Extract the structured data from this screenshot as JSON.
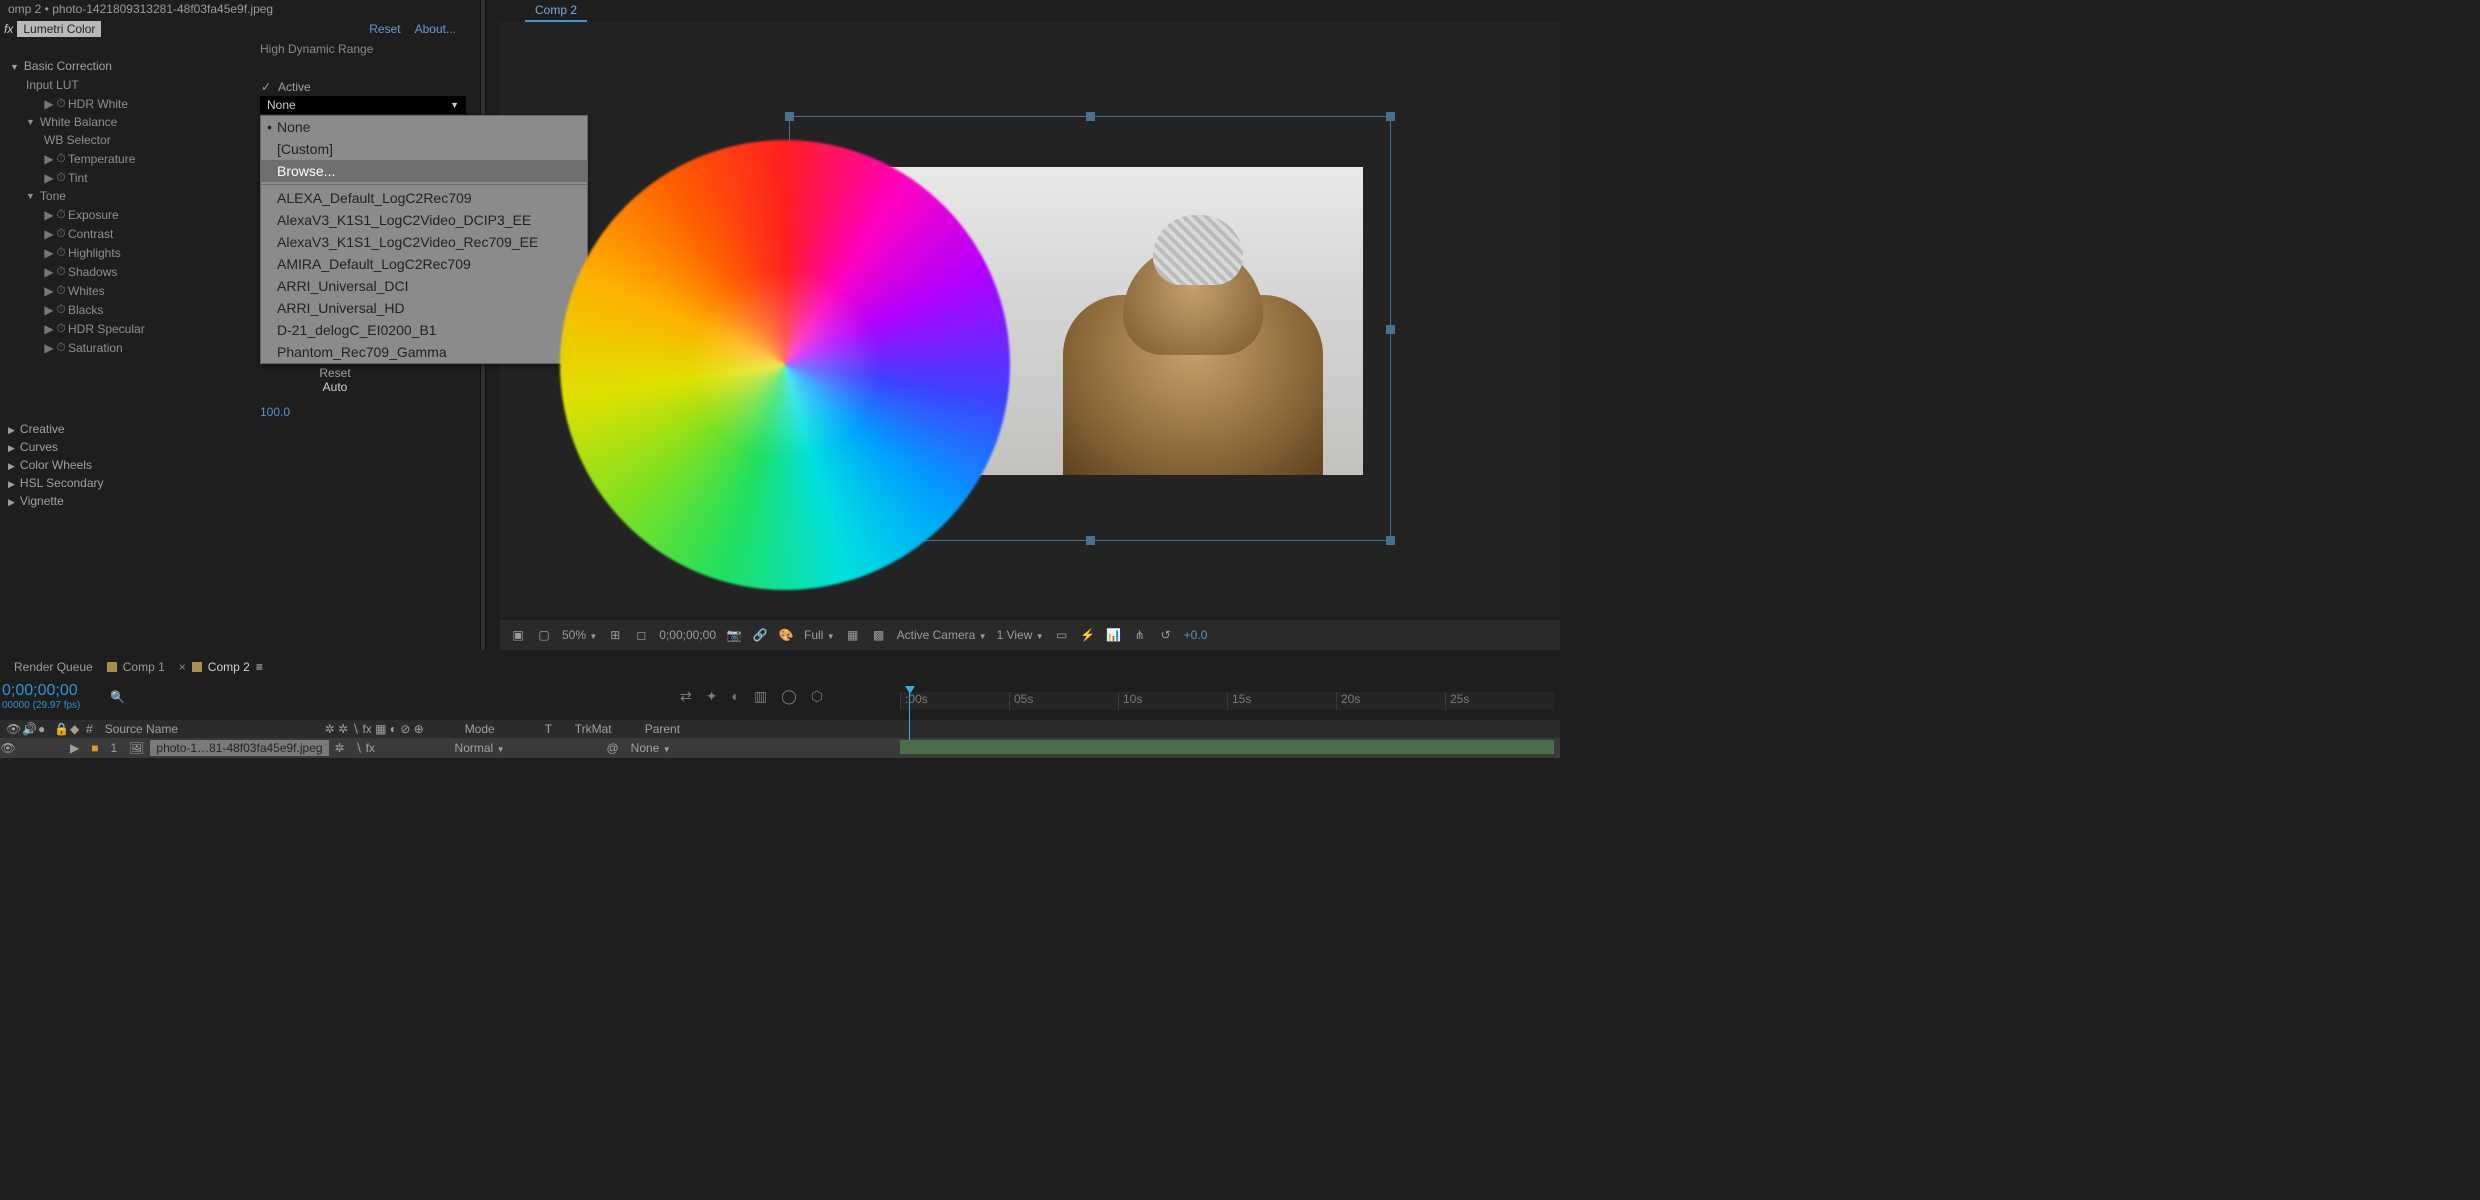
{
  "project_tab": "omp 2 • photo-1421809313281-48f03fa45e9f.jpeg",
  "viewer_tab": "Comp 2",
  "effect": {
    "fx_prefix": "fx",
    "name": "Lumetri Color",
    "reset": "Reset",
    "about": "About...",
    "hdr": "High Dynamic Range"
  },
  "active": {
    "check": "✓",
    "label": "Active"
  },
  "input_lut": {
    "label": "Input LUT",
    "selected": "None",
    "menu": {
      "none": "None",
      "custom": "[Custom]",
      "browse": "Browse...",
      "items": [
        "ALEXA_Default_LogC2Rec709",
        "AlexaV3_K1S1_LogC2Video_DCIP3_EE",
        "AlexaV3_K1S1_LogC2Video_Rec709_EE",
        "AMIRA_Default_LogC2Rec709",
        "ARRI_Universal_DCI",
        "ARRI_Universal_HD",
        "D-21_delogC_EI0200_B1",
        "Phantom_Rec709_Gamma"
      ]
    }
  },
  "sections": {
    "basic": "Basic Correction",
    "hdr_white": "HDR White",
    "wb": "White Balance",
    "wb_selector": "WB Selector",
    "temperature": "Temperature",
    "tint": "Tint",
    "tone": "Tone",
    "exposure": "Exposure",
    "contrast": "Contrast",
    "highlights": "Highlights",
    "shadows": "Shadows",
    "whites": "Whites",
    "blacks": "Blacks",
    "hdr_specular": "HDR Specular",
    "reset": "Reset",
    "auto": "Auto",
    "saturation": "Saturation",
    "saturation_val": "100.0",
    "creative": "Creative",
    "curves": "Curves",
    "color_wheels": "Color Wheels",
    "hsl": "HSL Secondary",
    "vignette": "Vignette"
  },
  "viewer_footer": {
    "zoom": "50%",
    "timecode": "0;00;00;00",
    "res": "Full",
    "camera": "Active Camera",
    "view": "1 View",
    "exposure": "+0.0"
  },
  "timeline": {
    "tabs": {
      "render_queue": "Render Queue",
      "comp1": "Comp 1",
      "comp2": "Comp 2"
    },
    "timecode": "0;00;00;00",
    "fps": "00000 (29.97 fps)",
    "headers": {
      "num": "#",
      "source": "Source Name",
      "mode": "Mode",
      "t": "T",
      "trkmat": "TrkMat",
      "parent": "Parent"
    },
    "layer": {
      "index": "1",
      "name": "photo-1…81-48f03fa45e9f.jpeg",
      "mode": "Normal",
      "parent": "None"
    },
    "ruler": [
      ":00s",
      "05s",
      "10s",
      "15s",
      "20s",
      "25s"
    ]
  }
}
